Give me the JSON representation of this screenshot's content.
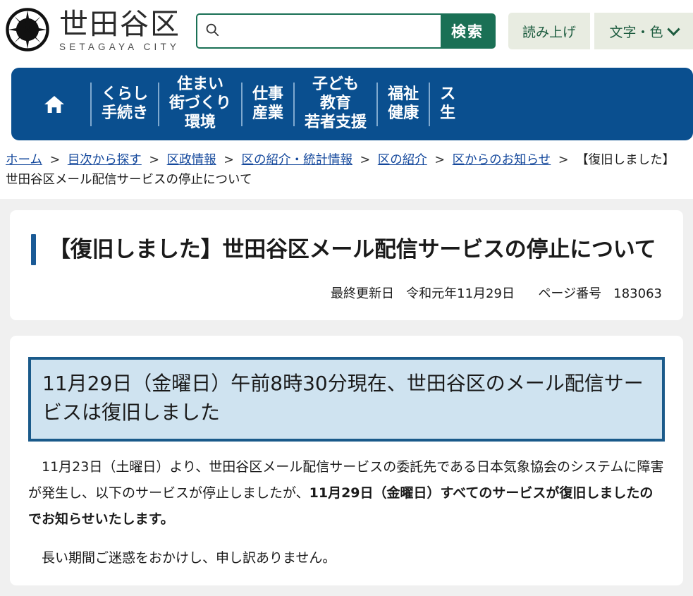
{
  "header": {
    "brand_jp": "世田谷区",
    "brand_en": "SETAGAYA CITY",
    "logo_icon": "setagaya-star-emblem",
    "search": {
      "icon": "search-icon",
      "value": "",
      "placeholder": "",
      "button_label": "検索"
    },
    "tools": [
      {
        "label": "読み上げ",
        "icon": ""
      },
      {
        "label": "文字・色",
        "icon": "chevron-down-icon"
      }
    ]
  },
  "nav": {
    "home_icon": "home-icon",
    "items": [
      {
        "lines": "くらし\n手続き"
      },
      {
        "lines": "住まい\n街づくり\n環境"
      },
      {
        "lines": "仕事\n産業"
      },
      {
        "lines": "子ども\n教育\n若者支援"
      },
      {
        "lines": "福祉\n健康"
      },
      {
        "lines": "ス\n生"
      }
    ]
  },
  "breadcrumb": {
    "links": [
      "ホーム",
      "目次から探す",
      "区政情報",
      "区の紹介・統計情報",
      "区の紹介",
      "区からのお知らせ"
    ],
    "separator": ">",
    "current": "【復旧しました】世田谷区メール配信サービスの停止について"
  },
  "article": {
    "title": "【復旧しました】世田谷区メール配信サービスの停止について",
    "meta_updated_label": "最終更新日",
    "meta_updated_value": "令和元年11月29日",
    "meta_page_label": "ページ番号",
    "meta_page_value": "183063",
    "notice": "11月29日（金曜日）午前8時30分現在、世田谷区のメール配信サービスは復旧しました",
    "paragraph1_plain1": "11月23日（土曜日）より、世田谷区メール配信サービスの委託先である日本気象協会のシステムに障害が発生し、以下のサービスが停止しましたが、",
    "paragraph1_bold": "11月29日（金曜日）すべてのサービスが復旧しましたのでお知らせいたします。",
    "paragraph2": "長い期間ご迷惑をおかけし、申し訳ありません。"
  },
  "colors": {
    "brand_green": "#1a7055",
    "nav_blue": "#0a4f8f",
    "accent_blue": "#1a5a96",
    "notice_bg": "#cfe3f0",
    "notice_border": "#1a5a8a",
    "link_blue": "#14489c",
    "page_bg": "#f0f0f0"
  }
}
